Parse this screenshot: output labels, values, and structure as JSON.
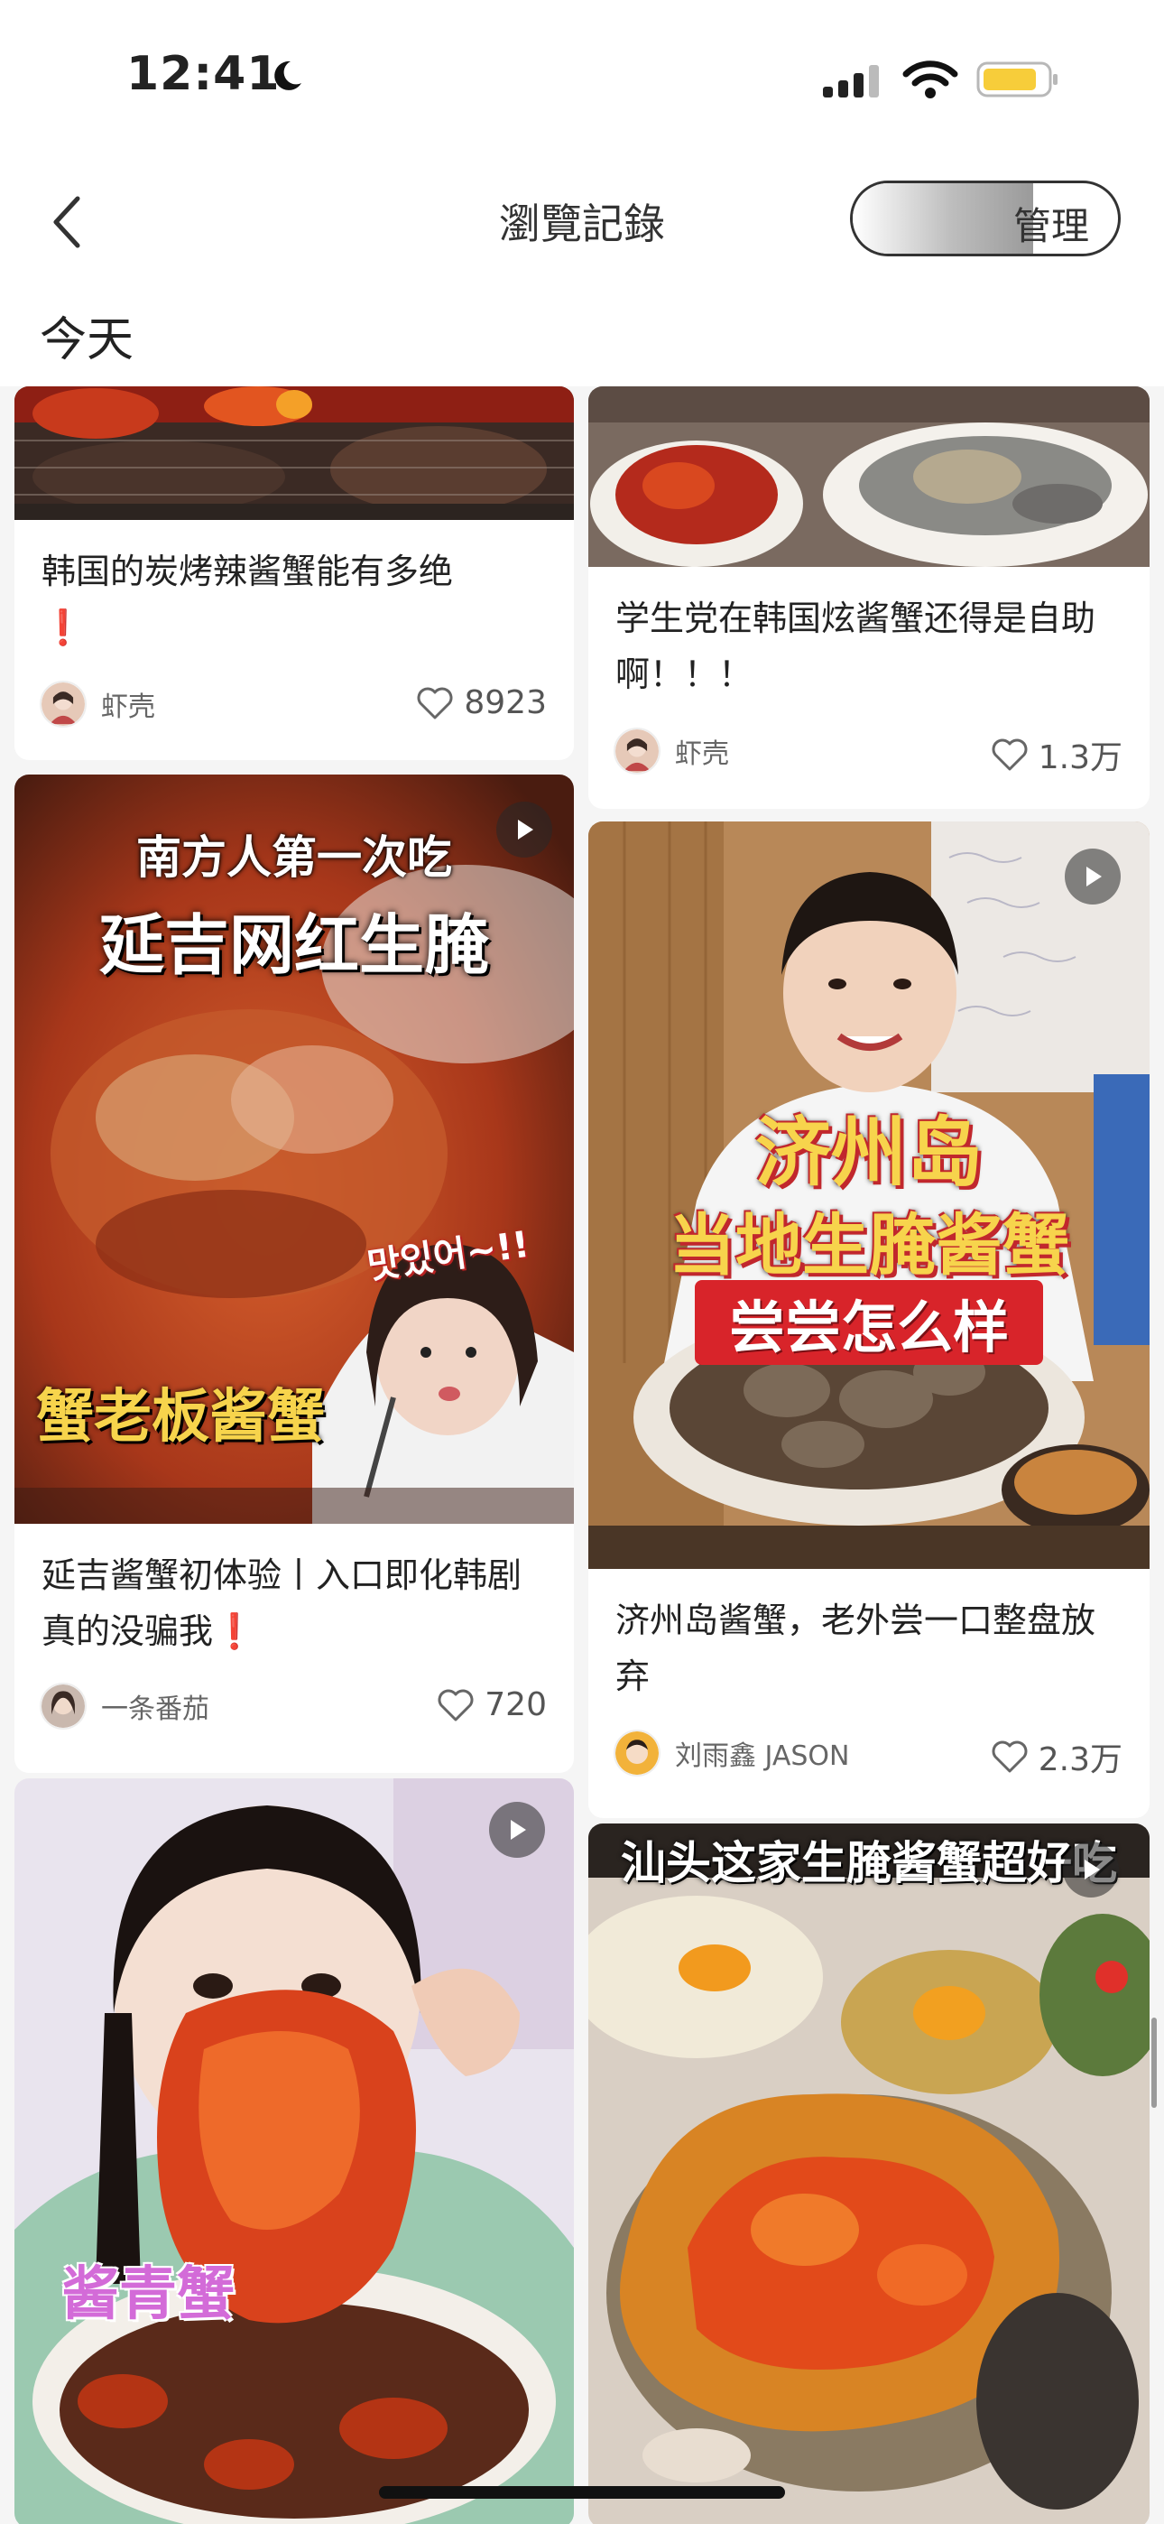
{
  "status_bar": {
    "time": "12:41"
  },
  "header": {
    "title": "瀏覽記錄",
    "manage_label": "管理"
  },
  "section_title": "今天",
  "cards": [
    {
      "title": "韩国的炭烤辣酱蟹能有多绝",
      "title_mark": "❗",
      "author": "虾壳",
      "likes": "8923"
    },
    {
      "title": "学生党在韩国炫酱蟹还得是自助啊！！！",
      "author": "虾壳",
      "likes": "1.3万"
    },
    {
      "title": "延吉酱蟹初体验丨入口即化韩剧真的没骗我",
      "title_mark": "❗",
      "author": "一条番茄",
      "likes": "720",
      "overlay": {
        "top": "南方人第一次吃",
        "main": "延吉网红生腌",
        "bottom": "蟹老板酱蟹",
        "korean": "맛있어~!!"
      }
    },
    {
      "title": "济州岛酱蟹，老外尝一口整盘放弃",
      "author": "刘雨鑫 JASON",
      "likes": "2.3万",
      "overlay": {
        "line1": "济州岛",
        "line2": "当地生腌酱蟹",
        "line3": "尝尝怎么样"
      }
    },
    {
      "overlay": {
        "main": "酱青蟹"
      }
    },
    {
      "overlay": {
        "top": "汕头这家生腌酱蟹超好吃"
      }
    }
  ],
  "colors": {
    "accent": "#e02424",
    "gold": "#f7d44c",
    "overlay_red": "#d8242a"
  }
}
